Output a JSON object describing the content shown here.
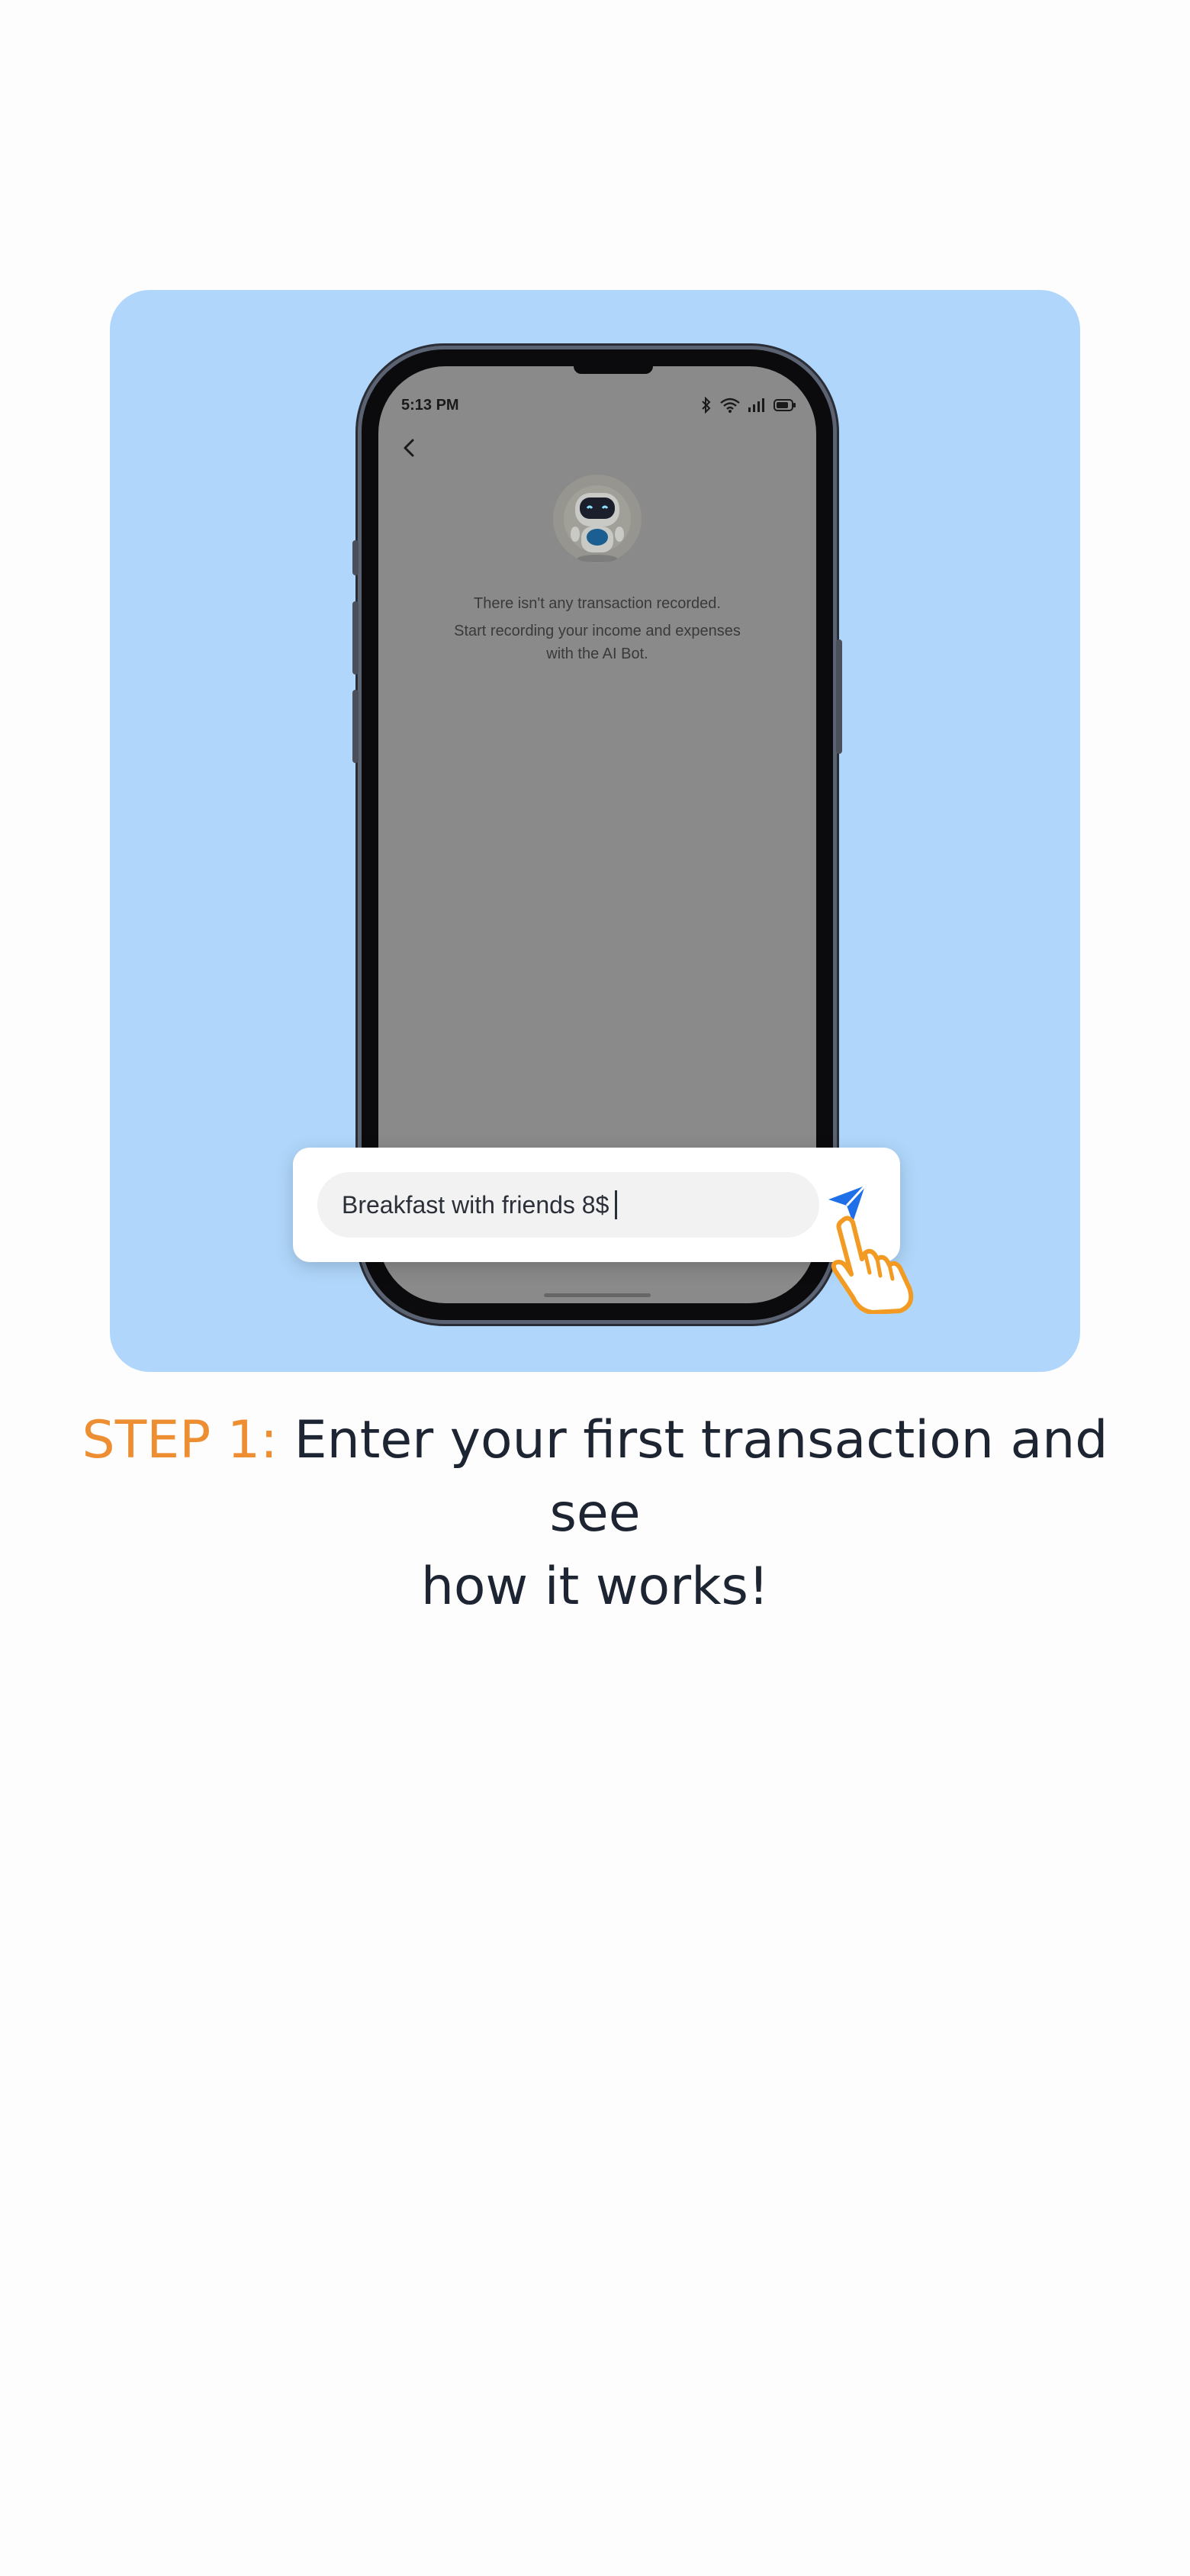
{
  "phone": {
    "status_time": "5:13 PM",
    "empty_title": "There isn't any transaction recorded.",
    "empty_body_line1": "Start recording your income and expenses",
    "empty_body_line2": "with the AI Bot."
  },
  "input": {
    "value": "Breakfast with friends 8$"
  },
  "caption": {
    "step_label": "STEP 1:",
    "text_line1": " Enter your first transaction and see",
    "text_line2": "how it works!"
  },
  "colors": {
    "card_bg": "#b0d7fb",
    "step_accent": "#ee8e33",
    "send_blue": "#1e6fe8",
    "hand_orange": "#f29a22"
  },
  "icons": [
    "back-chevron-icon",
    "robot-mascot-icon",
    "bluetooth-icon",
    "wifi-icon",
    "signal-icon",
    "battery-icon",
    "send-icon",
    "pointer-hand-icon"
  ]
}
